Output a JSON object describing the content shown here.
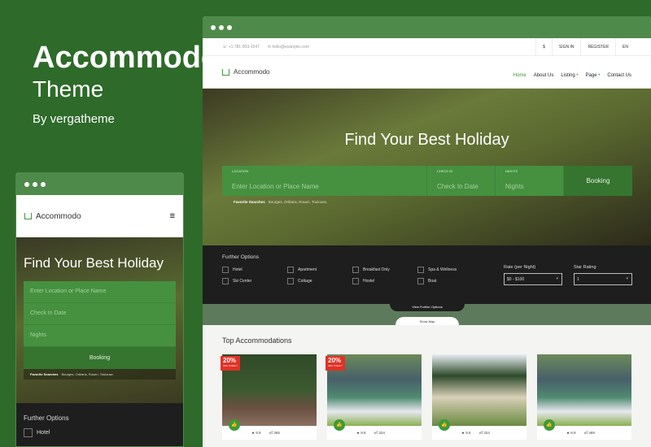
{
  "promo": {
    "title": "Accommodo",
    "subtitle": "Theme",
    "byline": "By vergatheme"
  },
  "colors": {
    "brand": "#3d9a38",
    "background": "#2e6a2a",
    "badge": "#e03226"
  },
  "desktop": {
    "topbar": {
      "phone": "+1 781-903-1047",
      "email": "hello@example.com",
      "currency": "$",
      "sign_in": "SIGN IN",
      "register": "REGISTER",
      "lang": "EN"
    },
    "logo": "Accommodo",
    "nav": [
      "Home",
      "About Us",
      "Listing",
      "Page",
      "Contact Us"
    ],
    "hero": {
      "title": "Find Your Best Holiday",
      "location_label": "LOCATION",
      "location_placeholder": "Enter Location or Place Name",
      "checkin_label": "CHECK IN",
      "checkin_placeholder": "Check In Date",
      "nights_label": "NIGHTS",
      "nights_placeholder": "Nights",
      "booking": "Booking",
      "fav_label": "Favorite Searches",
      "fav": "Bourges,  Orléans,  Rouen,  Toulouse,"
    },
    "further": {
      "title": "Further Options",
      "options": [
        "Hotel",
        "Apartment",
        "Breakfast Only",
        "Spa & Wellness",
        "Ski Center",
        "Cottage",
        "Hostel",
        "Boat"
      ],
      "rate_label": "Rate (per Night)",
      "rate_value": "$0 - $100",
      "star_label": "Star Rating",
      "star_value": "1",
      "view_more": "View Further Options",
      "show_map": "Show Map"
    },
    "top_title": "Top Accommodations",
    "cards": [
      {
        "badge": "20%",
        "badge_sub": "OFF TODAY!",
        "rating": "9.9",
        "size": "365"
      },
      {
        "badge": "20%",
        "badge_sub": "OFF TODAY!",
        "rating": "9.8",
        "size": "324"
      },
      {
        "rating": "9.8",
        "size": "324"
      },
      {
        "rating": "8.9",
        "size": "469"
      }
    ]
  },
  "mobile": {
    "logo": "Accommodo",
    "title": "Find Your Best Holiday",
    "location": "Enter Location or Place Name",
    "checkin": "Check In Date",
    "nights": "Nights",
    "booking": "Booking",
    "fav_label": "Favorite Searches",
    "fav": "Bourges,  Orléans,  Rouen,  Toulouse.",
    "further": "Further Options",
    "hotel": "Hotel"
  }
}
